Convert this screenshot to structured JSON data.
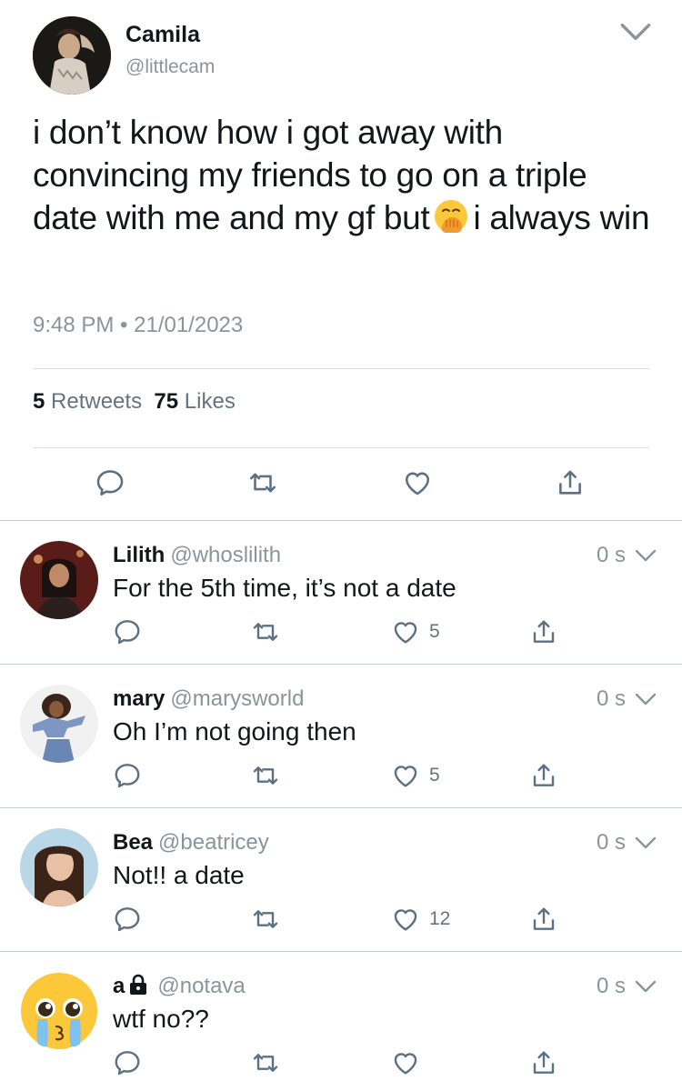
{
  "tweet": {
    "author_name": "Camila",
    "author_handle": "@littlecam",
    "text_part1": "i don’t know how i got away with convincing my friends to go on a triple date with me and my gf but",
    "emoji": "hand-over-mouth-emoji",
    "text_part2": "i always win",
    "timestamp": "9:48 PM • 21/01/2023",
    "retweets_count": "5",
    "retweets_label": "Retweets",
    "likes_count": "75",
    "likes_label": "Likes"
  },
  "replies": [
    {
      "name": "Lilith",
      "handle": "@whoslilith",
      "time": "0 s",
      "text": "For the 5th time, it’s not a date",
      "likes": "5"
    },
    {
      "name": "mary",
      "handle": "@marysworld",
      "time": "0 s",
      "text": "Oh I’m not going then",
      "likes": "5"
    },
    {
      "name": "Bea",
      "handle": "@beatricey",
      "time": "0 s",
      "text": "Not!! a date",
      "likes": "12"
    },
    {
      "name": "a",
      "handle": "@notava",
      "time": "0 s",
      "text": "wtf no??",
      "likes": ""
    }
  ],
  "icons": [
    "reply-icon",
    "retweet-icon",
    "like-icon",
    "share-icon",
    "chevron-down-icon",
    "lock-icon"
  ],
  "colors": {
    "text": "#14171a",
    "secondary": "#8a949c",
    "icon": "#5b7083",
    "divider": "#d9dee2"
  }
}
